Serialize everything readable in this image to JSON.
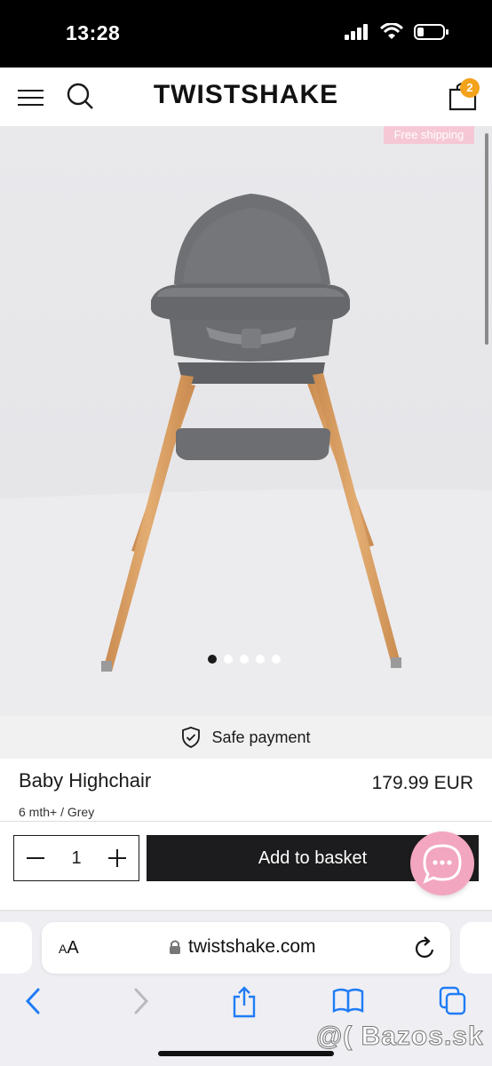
{
  "status_bar": {
    "time": "13:28"
  },
  "header": {
    "brand": "TWISTSHAKE",
    "cart_count": "2"
  },
  "promo": {
    "free_shipping": "Free shipping"
  },
  "gallery": {
    "dots": 5,
    "active_index": 0
  },
  "trust": {
    "safe_payment": "Safe payment"
  },
  "product": {
    "name": "Baby Highchair",
    "price": "179.99 EUR",
    "variant": "6 mth+ / Grey"
  },
  "purchase": {
    "quantity": "1",
    "add_label": "Add to basket"
  },
  "browser": {
    "aa_small": "A",
    "aa_large": "A",
    "url": "twistshake.com"
  },
  "watermark": "@( Bazos.sk",
  "colors": {
    "badge": "#f3a21c",
    "promo_bg": "#f6c8d6",
    "chat_bubble": "#f3a6bf",
    "basket_button": "#1c1c1e"
  }
}
